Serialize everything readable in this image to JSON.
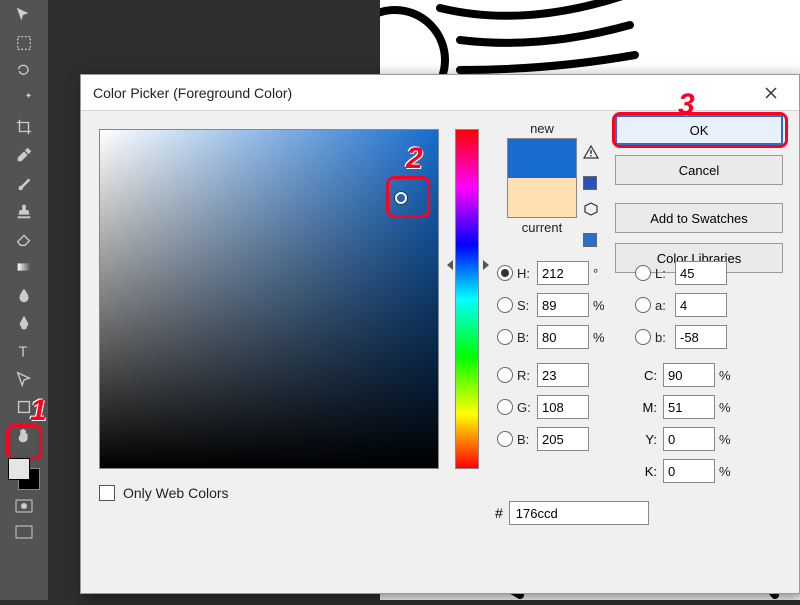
{
  "dialog": {
    "title": "Color Picker (Foreground Color)",
    "ok": "OK",
    "cancel": "Cancel",
    "add_swatches": "Add to Swatches",
    "color_libraries": "Color Libraries",
    "new_label": "new",
    "current_label": "current",
    "only_web": "Only Web Colors",
    "hex_prefix": "#",
    "hex_value": "176ccd",
    "fields": {
      "H": {
        "label": "H:",
        "value": "212",
        "unit": "°"
      },
      "S": {
        "label": "S:",
        "value": "89",
        "unit": "%"
      },
      "Bv": {
        "label": "B:",
        "value": "80",
        "unit": "%"
      },
      "R": {
        "label": "R:",
        "value": "23",
        "unit": ""
      },
      "G": {
        "label": "G:",
        "value": "108",
        "unit": ""
      },
      "Bc": {
        "label": "B:",
        "value": "205",
        "unit": ""
      },
      "L": {
        "label": "L:",
        "value": "45",
        "unit": ""
      },
      "a": {
        "label": "a:",
        "value": "4",
        "unit": ""
      },
      "b": {
        "label": "b:",
        "value": "-58",
        "unit": ""
      },
      "C": {
        "label": "C:",
        "value": "90",
        "unit": "%"
      },
      "M": {
        "label": "M:",
        "value": "51",
        "unit": "%"
      },
      "Y": {
        "label": "Y:",
        "value": "0",
        "unit": "%"
      },
      "K": {
        "label": "K:",
        "value": "0",
        "unit": "%"
      }
    },
    "colors": {
      "new": "#176ccd",
      "current": "#ffe0b2",
      "warn_sq1": "#2a52b8",
      "warn_sq2": "#2a6fc9"
    },
    "sv_picker": {
      "x_pct": 89,
      "y_pct": 20
    },
    "hue_pos_pct": 39
  },
  "annotations": {
    "n1": "1",
    "n2": "2",
    "n3": "3"
  },
  "toolbar": {
    "icons": [
      "move-icon",
      "marquee-icon",
      "lasso-icon",
      "wand-icon",
      "crop-icon",
      "eyedrop-icon",
      "heal-icon",
      "brush-icon",
      "stamp-icon",
      "history-icon",
      "eraser-icon",
      "gradient-icon",
      "blur-icon",
      "dodge-icon",
      "pen-icon",
      "type-icon",
      "path-icon",
      "rect-icon",
      "hand-icon",
      "zoom-icon"
    ]
  }
}
